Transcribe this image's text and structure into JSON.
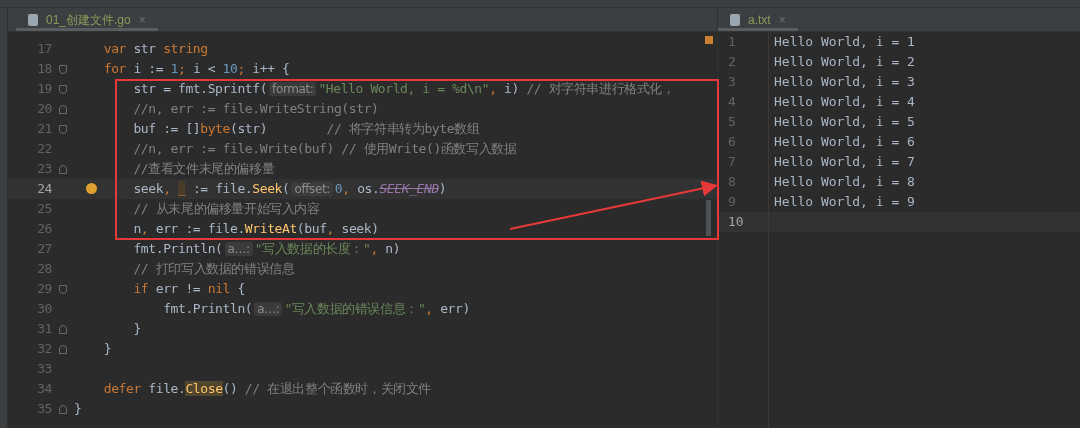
{
  "editor": {
    "tab": {
      "label": "01_创建文件.go",
      "close": "×",
      "selected": true
    },
    "lines": [
      {
        "number": "17",
        "current": false,
        "kind": "plain",
        "tokens": [
          {
            "kind": "kw",
            "text": "    var"
          },
          {
            "kind": "plain",
            "text": " str "
          },
          {
            "kind": "kw",
            "text": "string"
          }
        ]
      },
      {
        "number": "18",
        "current": false,
        "kind": "fold-start",
        "tokens": [
          {
            "kind": "kw",
            "text": "    for"
          },
          {
            "kind": "plain",
            "text": " i := "
          },
          {
            "kind": "num",
            "text": "1"
          },
          {
            "kind": "punct",
            "text": ";"
          },
          {
            "kind": "plain",
            "text": " i < "
          },
          {
            "kind": "num",
            "text": "10"
          },
          {
            "kind": "punct",
            "text": ";"
          },
          {
            "kind": "plain",
            "text": " i++ {"
          }
        ]
      },
      {
        "number": "19",
        "current": false,
        "kind": "fold-start",
        "tokens": [
          {
            "kind": "plain",
            "text": "        str = fmt.Sprintf("
          },
          {
            "kind": "hint",
            "text": "format:"
          },
          {
            "kind": "str",
            "text": "\"Hello World, i = %d\\n\""
          },
          {
            "kind": "punct",
            "text": ","
          },
          {
            "kind": "plain",
            "text": " i) "
          },
          {
            "kind": "cmt",
            "text": "// 对字符串进行格式化，"
          }
        ]
      },
      {
        "number": "20",
        "current": false,
        "kind": "fold-end",
        "tokens": [
          {
            "kind": "cmt",
            "text": "        //n, err := file.WriteString(str)"
          }
        ]
      },
      {
        "number": "21",
        "current": false,
        "kind": "fold-start",
        "tokens": [
          {
            "kind": "plain",
            "text": "        buf := []"
          },
          {
            "kind": "kw",
            "text": "byte"
          },
          {
            "kind": "plain",
            "text": "(str)        "
          },
          {
            "kind": "cmt",
            "text": "// 将字符串转为byte数组"
          }
        ]
      },
      {
        "number": "22",
        "current": false,
        "kind": "plain",
        "tokens": [
          {
            "kind": "cmt",
            "text": "        //n, err := file.Write(buf) // 使用Write()函数写入数据"
          }
        ]
      },
      {
        "number": "23",
        "current": false,
        "kind": "fold-end",
        "tokens": [
          {
            "kind": "cmt",
            "text": "        //查看文件末尾的偏移量"
          }
        ]
      },
      {
        "number": "24",
        "current": true,
        "kind": "plain",
        "tokens": [
          {
            "kind": "plain",
            "text": "        seek"
          },
          {
            "kind": "punct",
            "text": ", "
          },
          {
            "kind": "unused",
            "text": "_"
          },
          {
            "kind": "plain",
            "text": " := file."
          },
          {
            "kind": "fn",
            "text": "Seek"
          },
          {
            "kind": "plain",
            "text": "("
          },
          {
            "kind": "hint",
            "text": "offset:"
          },
          {
            "kind": "num",
            "text": "0"
          },
          {
            "kind": "punct",
            "text": ","
          },
          {
            "kind": "plain",
            "text": " os."
          },
          {
            "kind": "deprecated",
            "text": "SEEK_END"
          },
          {
            "kind": "plain",
            "text": ")"
          }
        ]
      },
      {
        "number": "25",
        "current": false,
        "kind": "plain",
        "tokens": [
          {
            "kind": "cmt",
            "text": "        // 从末尾的偏移量开始写入内容"
          }
        ]
      },
      {
        "number": "26",
        "current": false,
        "kind": "plain",
        "tokens": [
          {
            "kind": "plain",
            "text": "        n"
          },
          {
            "kind": "punct",
            "text": ","
          },
          {
            "kind": "plain",
            "text": " err := file."
          },
          {
            "kind": "fn",
            "text": "WriteAt"
          },
          {
            "kind": "plain",
            "text": "(buf"
          },
          {
            "kind": "punct",
            "text": ","
          },
          {
            "kind": "plain",
            "text": " seek)"
          }
        ]
      },
      {
        "number": "27",
        "current": false,
        "kind": "plain",
        "tokens": [
          {
            "kind": "plain",
            "text": "        fmt.Println("
          },
          {
            "kind": "hint",
            "text": "a…:"
          },
          {
            "kind": "str",
            "text": "\"写入数据的长度：\""
          },
          {
            "kind": "punct",
            "text": ","
          },
          {
            "kind": "plain",
            "text": " n)"
          }
        ]
      },
      {
        "number": "28",
        "current": false,
        "kind": "plain",
        "tokens": [
          {
            "kind": "cmt",
            "text": "        // 打印写入数据的错误信息"
          }
        ]
      },
      {
        "number": "29",
        "current": false,
        "kind": "fold-start",
        "tokens": [
          {
            "kind": "kw",
            "text": "        if"
          },
          {
            "kind": "plain",
            "text": " err != "
          },
          {
            "kind": "kw",
            "text": "nil"
          },
          {
            "kind": "plain",
            "text": " {"
          }
        ]
      },
      {
        "number": "30",
        "current": false,
        "kind": "plain",
        "tokens": [
          {
            "kind": "plain",
            "text": "            fmt.Println("
          },
          {
            "kind": "hint",
            "text": "a…:"
          },
          {
            "kind": "str",
            "text": "\"写入数据的错误信息：\""
          },
          {
            "kind": "punct",
            "text": ","
          },
          {
            "kind": "plain",
            "text": " err)"
          }
        ]
      },
      {
        "number": "31",
        "current": false,
        "kind": "fold-end",
        "tokens": [
          {
            "kind": "plain",
            "text": "        }"
          }
        ]
      },
      {
        "number": "32",
        "current": false,
        "kind": "fold-end",
        "tokens": [
          {
            "kind": "plain",
            "text": "    }"
          }
        ]
      },
      {
        "number": "33",
        "current": false,
        "kind": "plain"
      },
      {
        "number": "34",
        "current": false,
        "kind": "plain",
        "tokens": [
          {
            "kind": "kw",
            "text": "    defer"
          },
          {
            "kind": "plain",
            "text": " file."
          },
          {
            "kind": "usage",
            "text": "Close"
          },
          {
            "kind": "plain",
            "text": "() "
          },
          {
            "kind": "cmt",
            "text": "// 在退出整个函数时，关闭文件"
          }
        ]
      },
      {
        "number": "35",
        "current": false,
        "kind": "fold-end",
        "tokens": [
          {
            "kind": "plain",
            "text": "}"
          }
        ]
      }
    ]
  },
  "viewer": {
    "tab": {
      "label": "a.txt",
      "close": "×",
      "selected": true
    },
    "lines": [
      {
        "number": "1",
        "current": false,
        "text": "Hello World, i = 1"
      },
      {
        "number": "2",
        "current": false,
        "text": "Hello World, i = 2"
      },
      {
        "number": "3",
        "current": false,
        "text": "Hello World, i = 3"
      },
      {
        "number": "4",
        "current": false,
        "text": "Hello World, i = 4"
      },
      {
        "number": "5",
        "current": false,
        "text": "Hello World, i = 5"
      },
      {
        "number": "6",
        "current": false,
        "text": "Hello World, i = 6"
      },
      {
        "number": "7",
        "current": false,
        "text": "Hello World, i = 7"
      },
      {
        "number": "8",
        "current": false,
        "text": "Hello World, i = 8"
      },
      {
        "number": "9",
        "current": false,
        "text": "Hello World, i = 9"
      },
      {
        "number": "10",
        "current": true
      }
    ]
  }
}
